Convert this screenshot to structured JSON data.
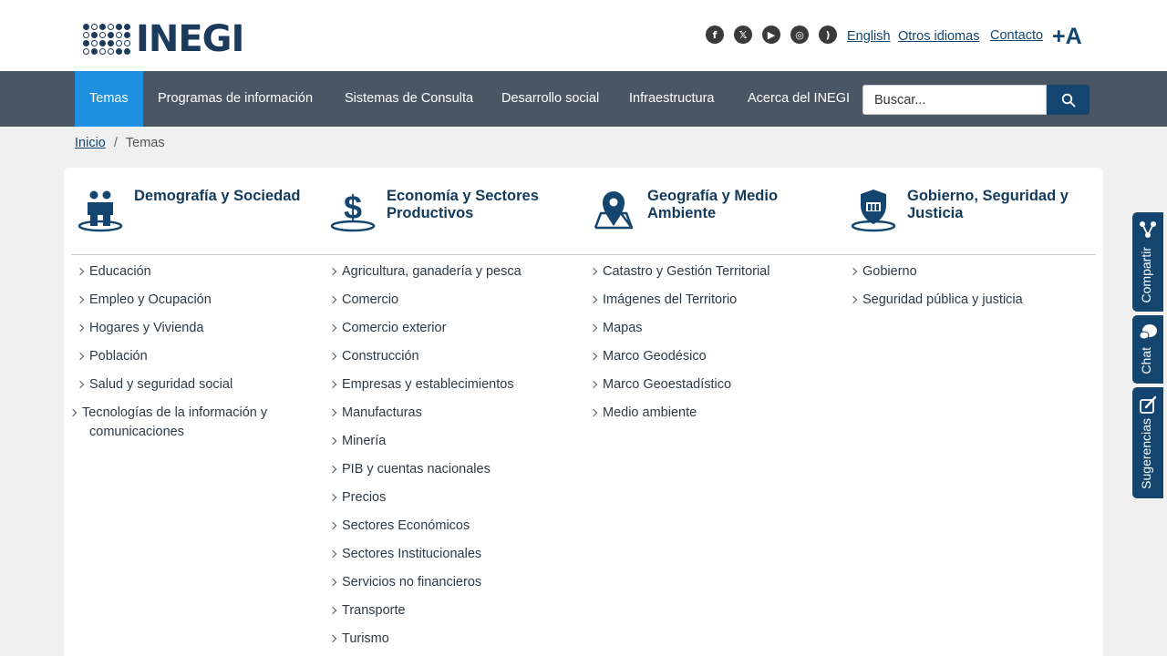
{
  "header": {
    "logo_text": "INEGI",
    "social_icons": [
      "facebook-icon",
      "x-icon",
      "youtube-icon",
      "instagram-icon",
      "rss-icon"
    ],
    "links": [
      "English",
      "Otros idiomas",
      "Contacto"
    ],
    "font_size_toggle": "+A"
  },
  "nav": {
    "items": [
      "Temas",
      "Programas de información",
      "Sistemas de Consulta",
      "Desarrollo social",
      "Infraestructura",
      "Acerca del INEGI"
    ],
    "search_placeholder": "Buscar..."
  },
  "breadcrumb": {
    "home": "Inicio",
    "separator": "/",
    "current": "Temas"
  },
  "columns": [
    {
      "icon": "people-icon",
      "title": "Demografía y Sociedad",
      "items": [
        "Educación",
        "Empleo y Ocupación",
        "Hogares y Vivienda",
        "Población",
        "Salud y seguridad social",
        "Tecnologías de la información y comunicaciones"
      ]
    },
    {
      "icon": "dollar-icon",
      "title": "Economía y Sectores Productivos",
      "items": [
        "Agricultura, ganadería y pesca",
        "Comercio",
        "Comercio exterior",
        "Construcción",
        "Empresas y establecimientos",
        "Manufacturas",
        "Minería",
        "PIB y cuentas nacionales",
        "Precios",
        "Sectores Económicos",
        "Sectores Institucionales",
        "Servicios no financieros",
        "Transporte",
        "Turismo"
      ]
    },
    {
      "icon": "map-pin-icon",
      "title": "Geografía y Medio Ambiente",
      "items": [
        "Catastro y Gestión Territorial",
        "Imágenes del Territorio",
        "Mapas",
        "Marco Geodésico",
        "Marco Geoestadístico",
        "Medio ambiente"
      ]
    },
    {
      "icon": "shield-icon",
      "title": "Gobierno, Seguridad y Justicia",
      "items": [
        "Gobierno",
        "Seguridad pública y justicia"
      ]
    }
  ],
  "side_tabs": [
    "Compartir",
    "Chat",
    "Sugerencias"
  ],
  "colors": {
    "navy": "#14456e",
    "nav_bg": "#4a5664",
    "active_tab": "#1f8fe0"
  }
}
